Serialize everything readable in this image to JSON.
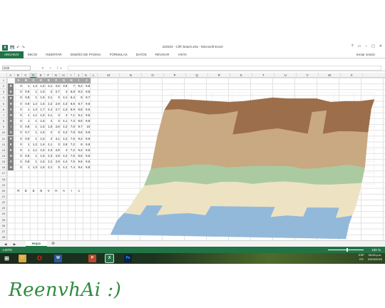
{
  "window": {
    "title": "220323 - CliFi beach.xlsx - Microsoft Excel",
    "controls": [
      "?",
      "▭",
      "–",
      "▢",
      "✕"
    ]
  },
  "ribbon": {
    "tabs": [
      "ARCHIVO",
      "INICIO",
      "INSERTAR",
      "DISEÑO DE PÁGINA",
      "FÓRMULAS",
      "DATOS",
      "REVISAR",
      "VISTA"
    ],
    "signin": "Iniciar sesión"
  },
  "formula_bar": {
    "name_box": "D30",
    "fx": "fx",
    "value": ""
  },
  "columns": [
    "A",
    "B",
    "C",
    "D",
    "E",
    "F",
    "G",
    "H",
    "I",
    "J",
    "K",
    "L",
    "M",
    "N",
    "O",
    "P",
    "Q",
    "R",
    "S",
    "T",
    "U",
    "V",
    "W",
    "X"
  ],
  "rows": [
    "1",
    "2",
    "3",
    "4",
    "5",
    "6",
    "7",
    "8",
    "9",
    "10",
    "11",
    "12",
    "13",
    "14",
    "15",
    "16",
    "17",
    "18",
    "19",
    "20",
    "21",
    "22",
    "23",
    "24",
    "25",
    "26",
    "27",
    "28"
  ],
  "sheet": {
    "header_row": [
      "A",
      "B",
      "C",
      "D",
      "E",
      "F",
      "G",
      "H",
      "I",
      "J"
    ],
    "row_letters": [
      "R",
      "E",
      "E",
      "N",
      "V",
      "H",
      "A",
      "I",
      "S",
      "R",
      "E",
      "E",
      "N",
      "V",
      "H"
    ],
    "values": [
      [
        "0",
        "1",
        "1,2",
        "1,5",
        "2,1",
        "2,5",
        "3,8",
        "7",
        "9,2",
        "9,8"
      ],
      [
        "0",
        "0,9",
        "1",
        "1,5",
        "2",
        "2,7",
        "4",
        "6,8",
        "9,3",
        "9,8"
      ],
      [
        "0",
        "0,8",
        "1",
        "1,5",
        "2,1",
        "3",
        "4,1",
        "6,4",
        "9",
        "9,7"
      ],
      [
        "0",
        "0,9",
        "1,2",
        "1,6",
        "2,2",
        "2,9",
        "4,3",
        "6,6",
        "8,7",
        "9,6"
      ],
      [
        "0",
        "1",
        "1,3",
        "1,7",
        "2,4",
        "2,7",
        "4,3",
        "6,9",
        "8,8",
        "9,5"
      ],
      [
        "0",
        "1",
        "1,1",
        "1,5",
        "2,1",
        "3",
        "4",
        "7,1",
        "9,1",
        "9,6"
      ],
      [
        "0",
        "1",
        "1",
        "1,5",
        "2",
        "3",
        "4,1",
        "7,3",
        "9,5",
        "9,8"
      ],
      [
        "0",
        "0,8",
        "1",
        "1,5",
        "1,8",
        "2,8",
        "4,2",
        "7,6",
        "9,7",
        "10"
      ],
      [
        "0",
        "0,7",
        "1",
        "1,5",
        "2",
        "3",
        "4,2",
        "7,8",
        "9,6",
        "9,9"
      ],
      [
        "0",
        "0,9",
        "1",
        "1,5",
        "2",
        "3,1",
        "4,2",
        "7,5",
        "9,2",
        "9,9"
      ],
      [
        "0",
        "1",
        "1,2",
        "1,6",
        "2,1",
        "3",
        "3,9",
        "7,2",
        "9",
        "9,9"
      ],
      [
        "0",
        "1",
        "1,1",
        "1,5",
        "2,3",
        "2,8",
        "4",
        "7,2",
        "9,2",
        "9,5"
      ],
      [
        "0",
        "0,9",
        "1",
        "1,5",
        "2,3",
        "2,8",
        "4,2",
        "7,5",
        "9,5",
        "9,6"
      ],
      [
        "0",
        "0,8",
        "1",
        "1,5",
        "2,2",
        "2,9",
        "4,4",
        "7,5",
        "9,5",
        "9,6"
      ],
      [
        "0",
        "1",
        "1,3",
        "1,5",
        "2,1",
        "3",
        "4,1",
        "7,4",
        "9,4",
        "9,8"
      ]
    ],
    "word_row": [
      "R",
      "E",
      "E",
      "N",
      "V",
      "H",
      "A",
      "I",
      "☺"
    ]
  },
  "chart_data": {
    "type": "surface",
    "title": "",
    "color_bands": [
      "#8fb7d9",
      "#ede3c2",
      "#a9c9a0",
      "#c7a77e",
      "#9a6a45"
    ],
    "series_count": 15,
    "points_per_series": 10
  },
  "sheet_tabs": {
    "active": "Hoja1",
    "add": "⊕",
    "nav": "◀ ▶"
  },
  "status": {
    "left": "LISTO",
    "zoom": "100 %"
  },
  "taskbar": {
    "apps": [
      "⊞",
      "🗀",
      "O",
      "W",
      "P",
      "X",
      "Ps"
    ],
    "tray_lang": "ESP",
    "tray_region": "ES",
    "time": "06:28 p.m.",
    "date": "20/03/2020"
  },
  "caption": "ReenvhAi :)"
}
